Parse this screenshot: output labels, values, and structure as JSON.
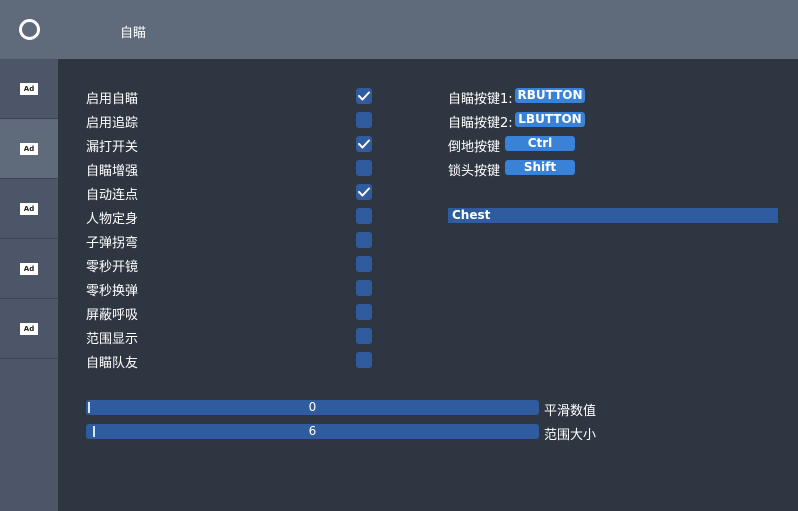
{
  "header": {
    "title": "自瞄"
  },
  "sidebar": {
    "logo_icon": "circle-logo-icon",
    "tabs": [
      {
        "label": "Ad",
        "active": false
      },
      {
        "label": "Ad",
        "active": true
      },
      {
        "label": "Ad",
        "active": false
      },
      {
        "label": "Ad",
        "active": false
      },
      {
        "label": "Ad",
        "active": false
      }
    ]
  },
  "options": [
    {
      "label": "启用自瞄",
      "checked": true
    },
    {
      "label": "启用追踪",
      "checked": false
    },
    {
      "label": "漏打开关",
      "checked": true
    },
    {
      "label": "自瞄增强",
      "checked": false
    },
    {
      "label": "自动连点",
      "checked": true
    },
    {
      "label": "人物定身",
      "checked": false
    },
    {
      "label": "子弹拐弯",
      "checked": false
    },
    {
      "label": "零秒开镜",
      "checked": false
    },
    {
      "label": "零秒换弹",
      "checked": false
    },
    {
      "label": "屏蔽呼吸",
      "checked": false
    },
    {
      "label": "范围显示",
      "checked": false
    },
    {
      "label": "自瞄队友",
      "checked": false
    }
  ],
  "keys": [
    {
      "label": "自瞄按键1:",
      "value": "RBUTTON"
    },
    {
      "label": "自瞄按键2:",
      "value": "LBUTTON"
    },
    {
      "label": "倒地按键",
      "value": "Ctrl"
    },
    {
      "label": "锁头按键",
      "value": "Shift"
    }
  ],
  "target_select": {
    "value": "Chest"
  },
  "sliders": [
    {
      "label": "平滑数值",
      "value": "0",
      "fraction": 0.0
    },
    {
      "label": "范围大小",
      "value": "6",
      "fraction": 0.012
    }
  ],
  "colors": {
    "background": "#2e3641",
    "header": "#5f6a7b",
    "checkbox": "#2f5c9f",
    "key_button": "#3a82d8"
  }
}
